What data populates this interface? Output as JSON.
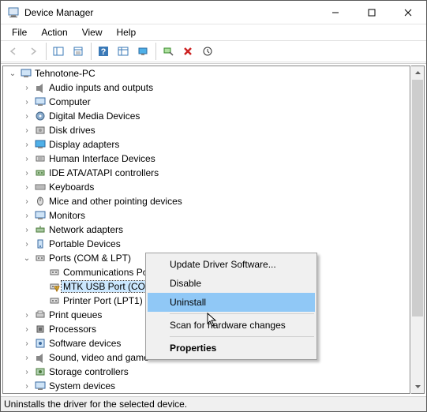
{
  "title": "Device Manager",
  "menubar": [
    "File",
    "Action",
    "View",
    "Help"
  ],
  "toolbar": {
    "back": "Back",
    "forward": "Forward",
    "showall": "Show hidden devices",
    "properties": "Properties",
    "help": "Help",
    "showhide": "Show/Hide console tree",
    "monitor": "View",
    "scan": "Scan for hardware changes",
    "uninstall": "Uninstall",
    "updates": "Update driver"
  },
  "root": "Tehnotone-PC",
  "categories": [
    {
      "label": "Audio inputs and outputs",
      "icon": "audio"
    },
    {
      "label": "Computer",
      "icon": "computer"
    },
    {
      "label": "Digital Media Devices",
      "icon": "media"
    },
    {
      "label": "Disk drives",
      "icon": "disk"
    },
    {
      "label": "Display adapters",
      "icon": "display"
    },
    {
      "label": "Human Interface Devices",
      "icon": "hid"
    },
    {
      "label": "IDE ATA/ATAPI controllers",
      "icon": "ide"
    },
    {
      "label": "Keyboards",
      "icon": "keyboard"
    },
    {
      "label": "Mice and other pointing devices",
      "icon": "mouse"
    },
    {
      "label": "Monitors",
      "icon": "monitor"
    },
    {
      "label": "Network adapters",
      "icon": "network"
    },
    {
      "label": "Portable Devices",
      "icon": "portable"
    }
  ],
  "ports": {
    "label": "Ports (COM & LPT)",
    "children": [
      {
        "label": "Communications Port (COM1)",
        "warn": false
      },
      {
        "label": "MTK USB Port (COM",
        "warn": true,
        "selected": true
      },
      {
        "label": "Printer Port (LPT1)",
        "warn": false
      }
    ]
  },
  "categories_after": [
    {
      "label": "Print queues",
      "icon": "print"
    },
    {
      "label": "Processors",
      "icon": "cpu"
    },
    {
      "label": "Software devices",
      "icon": "soft"
    },
    {
      "label": "Sound, video and game",
      "icon": "sound"
    },
    {
      "label": "Storage controllers",
      "icon": "storage"
    },
    {
      "label": "System devices",
      "icon": "system"
    }
  ],
  "contextmenu": [
    {
      "label": "Update Driver Software...",
      "type": "item"
    },
    {
      "label": "Disable",
      "type": "item"
    },
    {
      "label": "Uninstall",
      "type": "item",
      "hover": true
    },
    {
      "type": "sep"
    },
    {
      "label": "Scan for hardware changes",
      "type": "item"
    },
    {
      "type": "sep"
    },
    {
      "label": "Properties",
      "type": "item",
      "bold": true
    }
  ],
  "statusbar": "Uninstalls the driver for the selected device."
}
